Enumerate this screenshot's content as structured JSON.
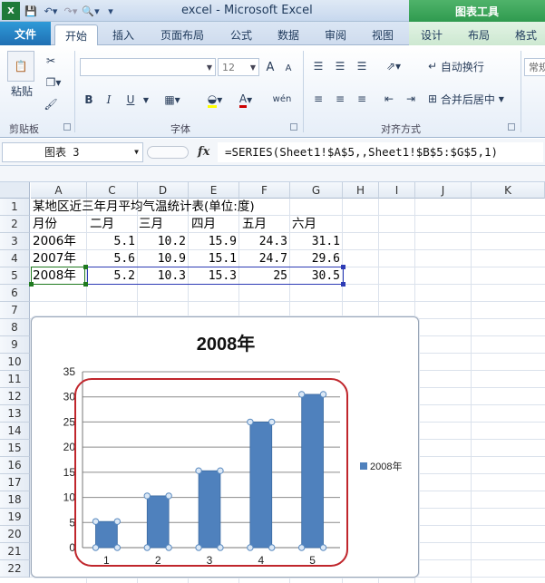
{
  "window": {
    "title": "excel  -  Microsoft Excel",
    "context_tab_group": "图表工具"
  },
  "ribbon_tabs": [
    {
      "label": "文件"
    },
    {
      "label": "开始"
    },
    {
      "label": "插入"
    },
    {
      "label": "页面布局"
    },
    {
      "label": "公式"
    },
    {
      "label": "数据"
    },
    {
      "label": "审阅"
    },
    {
      "label": "视图"
    },
    {
      "label": "设计"
    },
    {
      "label": "布局"
    },
    {
      "label": "格式"
    }
  ],
  "ribbon": {
    "clipboard": {
      "paste": "粘贴",
      "group": "剪贴板"
    },
    "font": {
      "size": "12",
      "group": "字体",
      "bold": "B",
      "italic": "I",
      "underline": "U",
      "grow": "A",
      "shrink": "A",
      "font_color": "A",
      "phonetic": "wén"
    },
    "alignment": {
      "wrap": "自动换行",
      "merge": "合并后居中",
      "group": "对齐方式"
    },
    "number": {
      "format": "常规"
    }
  },
  "formula_bar": {
    "name_box": "图表 3",
    "fx": "fx",
    "formula": "=SERIES(Sheet1!$A$5,,Sheet1!$B$5:$G$5,1)"
  },
  "sheet": {
    "columns": [
      "A",
      "C",
      "D",
      "E",
      "F",
      "G",
      "H",
      "I",
      "J",
      "K"
    ],
    "rows": [
      "1",
      "2",
      "3",
      "4",
      "5",
      "6",
      "7",
      "8",
      "9",
      "10",
      "11",
      "12",
      "13",
      "14",
      "15",
      "16",
      "17",
      "18",
      "19",
      "20",
      "21",
      "22"
    ],
    "title": "某地区近三年月平均气温统计表(单位:度)",
    "header": [
      "月份",
      "二月",
      "三月",
      "四月",
      "五月",
      "六月"
    ],
    "data": [
      [
        "2006年",
        "5.1",
        "10.2",
        "15.9",
        "24.3",
        "31.1"
      ],
      [
        "2007年",
        "5.6",
        "10.9",
        "15.1",
        "24.7",
        "29.6"
      ],
      [
        "2008年",
        "5.2",
        "10.3",
        "15.3",
        "25",
        "30.5"
      ]
    ]
  },
  "colors": {
    "bar": "#4f81bd",
    "highlight": "#c0262c",
    "selection": "#1f7a1f"
  },
  "chart_data": {
    "type": "bar",
    "title": "2008年",
    "categories": [
      "1",
      "2",
      "3",
      "4",
      "5"
    ],
    "series": [
      {
        "name": "2008年",
        "values": [
          5.2,
          10.3,
          15.3,
          25,
          30.5
        ]
      }
    ],
    "yticks": [
      "0",
      "5",
      "10",
      "15",
      "20",
      "25",
      "30",
      "35"
    ],
    "ylim": [
      0,
      35
    ],
    "grid": true,
    "legend": "right"
  }
}
